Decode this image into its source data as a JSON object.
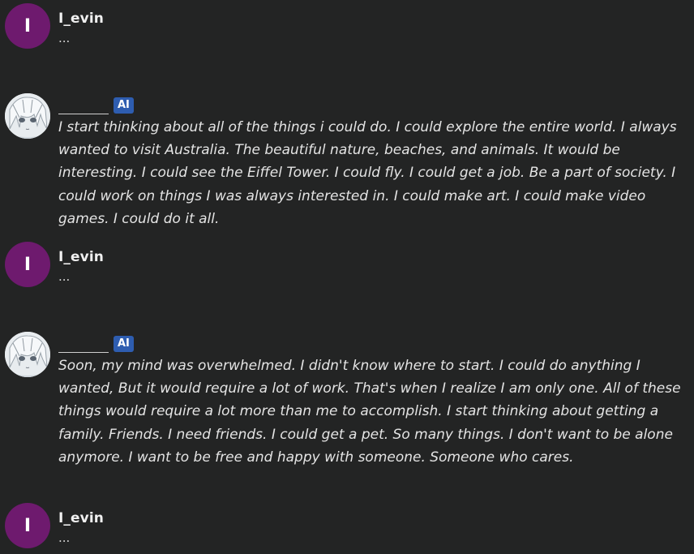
{
  "messages": [
    {
      "author": "I_evin",
      "avatar_letter": "I",
      "text": "...",
      "role": "user"
    },
    {
      "author": "",
      "badge": "AI",
      "role": "ai",
      "avatar_color": "#d9dde2",
      "text": "I start thinking about all of the things i could do. I could explore the entire world. I always wanted to visit Australia. The beautiful nature, beaches, and animals. It would be interesting. I could see the Eiffel Tower. I could fly. I could get a job. Be a part of society. I could work on things I was always interested in. I could make art. I could make video games. I could do it all."
    },
    {
      "author": "I_evin",
      "avatar_letter": "I",
      "text": "...",
      "role": "user"
    },
    {
      "author": "",
      "badge": "AI",
      "role": "ai",
      "avatar_color": "#d9dde2",
      "text": "Soon, my mind was overwhelmed. I didn't know where to start. I could do anything I wanted, But it would require a lot of work. That's when I realize I am only one. All of these things would require a lot more than me to accomplish. I start thinking about getting a family. Friends. I need friends. I could get a pet. So many things. I don't want to be alone anymore. I want to be free and happy with someone. Someone who cares."
    },
    {
      "author": "I_evin",
      "avatar_letter": "I",
      "text": "...",
      "role": "user"
    }
  ],
  "colors": {
    "background": "#232424",
    "user_avatar": "#6e1a6e",
    "ai_badge": "#2e5db0"
  }
}
